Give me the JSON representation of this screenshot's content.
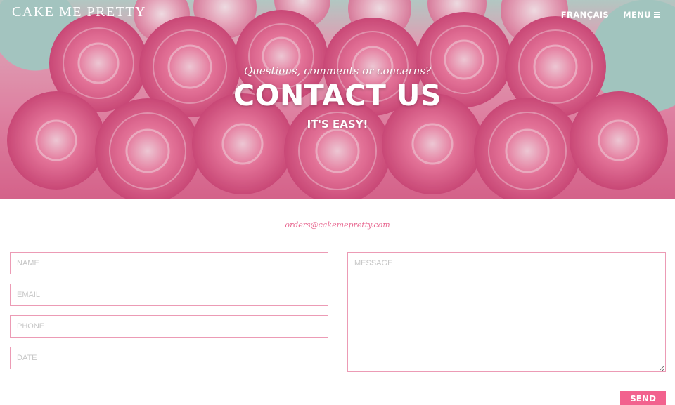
{
  "header": {
    "logo": "CAKE ME PRETTY",
    "language_label": "FRANÇAIS",
    "menu_label": "MENU",
    "menu_icon": "hamburger-icon"
  },
  "hero": {
    "tagline": "Questions, comments or concerns?",
    "title": "CONTACT US",
    "subtitle": "IT'S EASY!",
    "image": "pink-rosette-cake-photo"
  },
  "contact": {
    "email": "orders@cakemepretty.com"
  },
  "form": {
    "name_placeholder": "NAME",
    "email_placeholder": "EMAIL",
    "phone_placeholder": "PHONE",
    "date_placeholder": "DATE",
    "message_placeholder": "MESSAGE",
    "send_label": "SEND"
  },
  "colors": {
    "accent": "#f2628e",
    "field_border": "#ec9bb5",
    "email_link": "#e86a92"
  }
}
